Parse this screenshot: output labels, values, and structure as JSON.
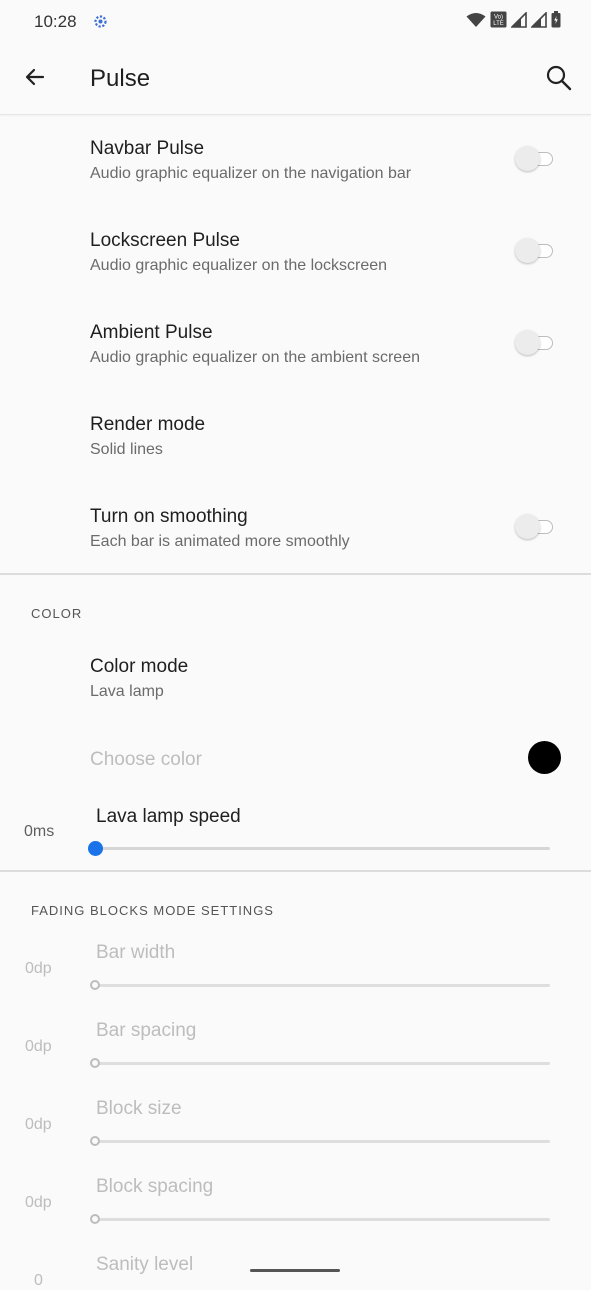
{
  "status_bar": {
    "time": "10:28",
    "icons": [
      "settings-notification-icon",
      "wifi-icon",
      "volte-icon",
      "signal-icon",
      "signal-icon",
      "battery-icon"
    ],
    "volte_label": "Vo)\nLTE"
  },
  "app_bar": {
    "title": "Pulse",
    "back_icon": "arrow-back-icon",
    "search_icon": "search-icon"
  },
  "preferences": [
    {
      "title": "Navbar Pulse",
      "summary": "Audio graphic equalizer on the navigation bar",
      "switch": false
    },
    {
      "title": "Lockscreen Pulse",
      "summary": "Audio graphic equalizer on the lockscreen",
      "switch": false
    },
    {
      "title": "Ambient Pulse",
      "summary": "Audio graphic equalizer on the ambient screen",
      "switch": false
    },
    {
      "title": "Render mode",
      "summary": "Solid lines"
    },
    {
      "title": "Turn on smoothing",
      "summary": "Each bar is animated more smoothly",
      "switch": false
    }
  ],
  "color_section": {
    "header": "COLOR",
    "color_mode": {
      "title": "Color mode",
      "summary": "Lava lamp"
    },
    "choose_color": {
      "title": "Choose color",
      "color": "#000000",
      "enabled": false
    },
    "lava_lamp_speed": {
      "title": "Lava lamp speed",
      "value": "0ms",
      "position": 0
    }
  },
  "fading_section": {
    "header": "FADING BLOCKS MODE SETTINGS",
    "sliders": [
      {
        "title": "Bar width",
        "value": "0dp",
        "position": 0,
        "enabled": false
      },
      {
        "title": "Bar spacing",
        "value": "0dp",
        "position": 0,
        "enabled": false
      },
      {
        "title": "Block size",
        "value": "0dp",
        "position": 0,
        "enabled": false
      },
      {
        "title": "Block spacing",
        "value": "0dp",
        "position": 0,
        "enabled": false
      },
      {
        "title": "Sanity level",
        "value": "0",
        "position": 0,
        "enabled": false
      }
    ]
  },
  "colors": {
    "accent": "#1a73e8",
    "disabled": "#bdbdbd",
    "background": "#fafafa"
  }
}
